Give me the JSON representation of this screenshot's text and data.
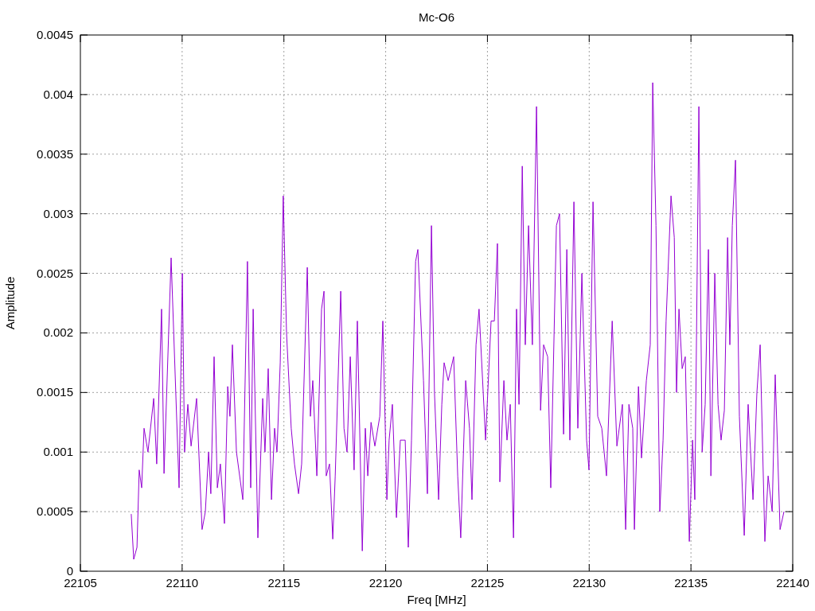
{
  "chart_data": {
    "type": "line",
    "grid": true,
    "title": "Mc-O6",
    "xlabel": "Freq [MHz]",
    "ylabel": "Amplitude",
    "xlim": [
      22105,
      22140
    ],
    "ylim": [
      0,
      0.0045
    ],
    "xticks": [
      22105,
      22110,
      22115,
      22120,
      22125,
      22130,
      22135,
      22140
    ],
    "yticks": [
      {
        "value": 0,
        "label": "0"
      },
      {
        "value": 0.0005,
        "label": "0.0005"
      },
      {
        "value": 0.001,
        "label": "0.001"
      },
      {
        "value": 0.0015,
        "label": "0.0015"
      },
      {
        "value": 0.002,
        "label": "0.002"
      },
      {
        "value": 0.0025,
        "label": "0.0025"
      },
      {
        "value": 0.003,
        "label": "0.003"
      },
      {
        "value": 0.0035,
        "label": "0.0035"
      },
      {
        "value": 0.004,
        "label": "0.004"
      },
      {
        "value": 0.0045,
        "label": "0.0045"
      }
    ],
    "x": [
      22107.5,
      22107.62,
      22107.78,
      22107.89,
      22108.01,
      22108.13,
      22108.32,
      22108.6,
      22108.75,
      22108.99,
      22109.11,
      22109.46,
      22109.85,
      22110.01,
      22110.12,
      22110.28,
      22110.44,
      22110.71,
      22110.98,
      22111.14,
      22111.3,
      22111.41,
      22111.57,
      22111.73,
      22111.88,
      22112.08,
      22112.24,
      22112.35,
      22112.47,
      22112.67,
      22112.98,
      22113.21,
      22113.37,
      22113.49,
      22113.72,
      22113.96,
      22114.07,
      22114.23,
      22114.39,
      22114.54,
      22114.66,
      22114.82,
      22114.97,
      22115.13,
      22115.36,
      22115.52,
      22115.72,
      22115.87,
      22116.15,
      22116.3,
      22116.42,
      22116.62,
      22116.85,
      22116.97,
      22117.08,
      22117.24,
      22117.4,
      22117.52,
      22117.79,
      22117.95,
      22118.1,
      22118.26,
      22118.45,
      22118.61,
      22118.85,
      22119.0,
      22119.12,
      22119.28,
      22119.47,
      22119.71,
      22119.86,
      22120.06,
      22120.17,
      22120.33,
      22120.53,
      22120.72,
      22120.96,
      22121.11,
      22121.27,
      22121.47,
      22121.58,
      22121.86,
      22122.05,
      22122.25,
      22122.4,
      22122.6,
      22122.76,
      22122.87,
      22123.07,
      22123.34,
      22123.54,
      22123.69,
      22123.93,
      22124.12,
      22124.24,
      22124.44,
      22124.59,
      22124.91,
      22125.18,
      22125.34,
      22125.49,
      22125.61,
      22125.81,
      22125.96,
      22126.12,
      22126.28,
      22126.43,
      22126.55,
      22126.71,
      22126.86,
      22127.02,
      22127.21,
      22127.41,
      22127.61,
      22127.76,
      22127.96,
      22128.11,
      22128.39,
      22128.54,
      22128.74,
      22128.9,
      22129.05,
      22129.25,
      22129.44,
      22129.64,
      22129.87,
      22129.99,
      22130.19,
      22130.42,
      22130.62,
      22130.85,
      22131.13,
      22131.36,
      22131.63,
      22131.79,
      22131.95,
      22132.14,
      22132.22,
      22132.42,
      22132.57,
      22132.81,
      22133.0,
      22133.12,
      22133.28,
      22133.47,
      22133.63,
      22133.78,
      22134.02,
      22134.18,
      22134.29,
      22134.41,
      22134.57,
      22134.72,
      22134.92,
      22135.08,
      22135.19,
      22135.39,
      22135.55,
      22135.7,
      22135.86,
      22135.98,
      22136.17,
      22136.33,
      22136.48,
      22136.64,
      22136.8,
      22136.91,
      22137.03,
      22137.19,
      22137.38,
      22137.62,
      22137.81,
      22138.05,
      22138.24,
      22138.4,
      22138.63,
      22138.79,
      22138.99,
      22139.14,
      22139.38,
      22139.57
    ],
    "series": [
      {
        "color": "#9400d3",
        "values": [
          0.00048,
          0.0001,
          0.0002,
          0.00085,
          0.0007,
          0.0012,
          0.001,
          0.00145,
          0.0009,
          0.0022,
          0.00082,
          0.00263,
          0.0007,
          0.0025,
          0.001,
          0.0014,
          0.00105,
          0.00145,
          0.00035,
          0.0005,
          0.001,
          0.00065,
          0.0018,
          0.0007,
          0.0009,
          0.0004,
          0.00155,
          0.0013,
          0.0019,
          0.001,
          0.0006,
          0.0026,
          0.0007,
          0.0022,
          0.00028,
          0.00145,
          0.001,
          0.0017,
          0.0006,
          0.0012,
          0.001,
          0.00175,
          0.00315,
          0.002,
          0.0012,
          0.0009,
          0.00065,
          0.0009,
          0.00255,
          0.0013,
          0.0016,
          0.0008,
          0.0022,
          0.00235,
          0.0008,
          0.0009,
          0.00027,
          0.0008,
          0.00235,
          0.0012,
          0.001,
          0.0018,
          0.00085,
          0.0021,
          0.00017,
          0.0012,
          0.0008,
          0.00125,
          0.00105,
          0.0013,
          0.0021,
          0.0006,
          0.0011,
          0.0014,
          0.00045,
          0.0011,
          0.0011,
          0.0002,
          0.0011,
          0.0026,
          0.0027,
          0.0016,
          0.00065,
          0.0029,
          0.0015,
          0.0006,
          0.0014,
          0.00175,
          0.0016,
          0.0018,
          0.0008,
          0.00028,
          0.0016,
          0.0012,
          0.0006,
          0.0019,
          0.0022,
          0.0011,
          0.0021,
          0.0021,
          0.00275,
          0.00075,
          0.0016,
          0.0011,
          0.0014,
          0.00028,
          0.0022,
          0.0014,
          0.0034,
          0.0019,
          0.0029,
          0.0019,
          0.0039,
          0.00135,
          0.0019,
          0.0018,
          0.0007,
          0.0029,
          0.003,
          0.00115,
          0.0027,
          0.0011,
          0.0031,
          0.0012,
          0.0025,
          0.0011,
          0.00085,
          0.0031,
          0.0013,
          0.0012,
          0.0008,
          0.0021,
          0.00105,
          0.0014,
          0.00035,
          0.0014,
          0.0012,
          0.00035,
          0.00155,
          0.00095,
          0.0016,
          0.0019,
          0.0041,
          0.0029,
          0.0005,
          0.0011,
          0.0021,
          0.00315,
          0.0028,
          0.0015,
          0.0022,
          0.0017,
          0.0018,
          0.00025,
          0.0011,
          0.0006,
          0.0039,
          0.001,
          0.0014,
          0.0027,
          0.0008,
          0.0025,
          0.0014,
          0.0011,
          0.00135,
          0.0028,
          0.0019,
          0.0029,
          0.00345,
          0.0013,
          0.0003,
          0.0014,
          0.0006,
          0.0015,
          0.0019,
          0.00025,
          0.0008,
          0.0005,
          0.00165,
          0.00035,
          0.0005
        ]
      }
    ]
  }
}
